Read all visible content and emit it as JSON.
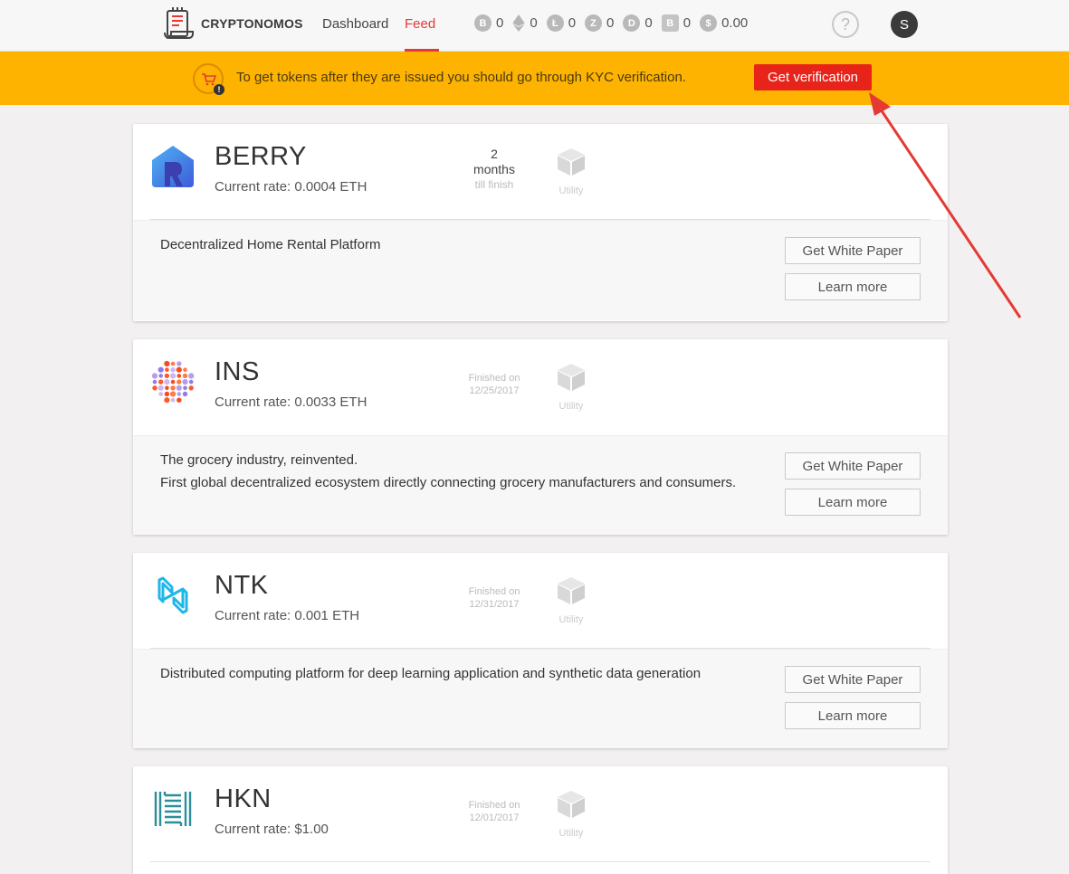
{
  "header": {
    "brand": "CRYPTONOMOS",
    "nav": [
      {
        "label": "Dashboard",
        "active": false
      },
      {
        "label": "Feed",
        "active": true
      }
    ],
    "balances": [
      {
        "icon": "bitcoin-icon",
        "glyph": "B",
        "value": "0"
      },
      {
        "icon": "ethereum-icon",
        "glyph": "",
        "value": "0"
      },
      {
        "icon": "litecoin-icon",
        "glyph": "Ł",
        "value": "0"
      },
      {
        "icon": "zcash-icon",
        "glyph": "Z",
        "value": "0"
      },
      {
        "icon": "dash-icon",
        "glyph": "D",
        "value": "0"
      },
      {
        "icon": "bitcoin-cash-icon",
        "glyph": "B",
        "value": "0"
      },
      {
        "icon": "dollar-icon",
        "glyph": "$",
        "value": "0.00"
      }
    ],
    "help_glyph": "?",
    "avatar_initial": "S"
  },
  "banner": {
    "message": "To get tokens after they are issued you should go through KYC verification.",
    "button_label": "Get verification"
  },
  "cards": [
    {
      "name": "BERRY",
      "rate": "Current rate: 0.0004 ETH",
      "status": {
        "kind": "countdown",
        "line1": "2",
        "line2": "months",
        "line3": "till finish"
      },
      "type_label": "Utility",
      "description": [
        "Decentralized Home Rental Platform"
      ],
      "white_paper_label": "Get White Paper",
      "learn_more_label": "Learn more"
    },
    {
      "name": "INS",
      "rate": "Current rate: 0.0033 ETH",
      "status": {
        "kind": "finished",
        "label": "Finished on",
        "date": "12/25/2017"
      },
      "type_label": "Utility",
      "description": [
        "The grocery industry, reinvented.",
        "First global decentralized ecosystem directly connecting grocery manufacturers and consumers."
      ],
      "white_paper_label": "Get White Paper",
      "learn_more_label": "Learn more"
    },
    {
      "name": "NTK",
      "rate": "Current rate: 0.001 ETH",
      "status": {
        "kind": "finished",
        "label": "Finished on",
        "date": "12/31/2017"
      },
      "type_label": "Utility",
      "description": [
        "Distributed computing platform for deep learning application and synthetic data generation"
      ],
      "white_paper_label": "Get White Paper",
      "learn_more_label": "Learn more"
    },
    {
      "name": "HKN",
      "rate": "Current rate: $1.00",
      "status": {
        "kind": "finished",
        "label": "Finished on",
        "date": "12/01/2017"
      },
      "type_label": "Utility"
    }
  ],
  "colors": {
    "accent_red": "#e53935",
    "banner_yellow": "#fdb300",
    "verify_button": "#e8241a",
    "annotation_arrow": "#e53935"
  }
}
